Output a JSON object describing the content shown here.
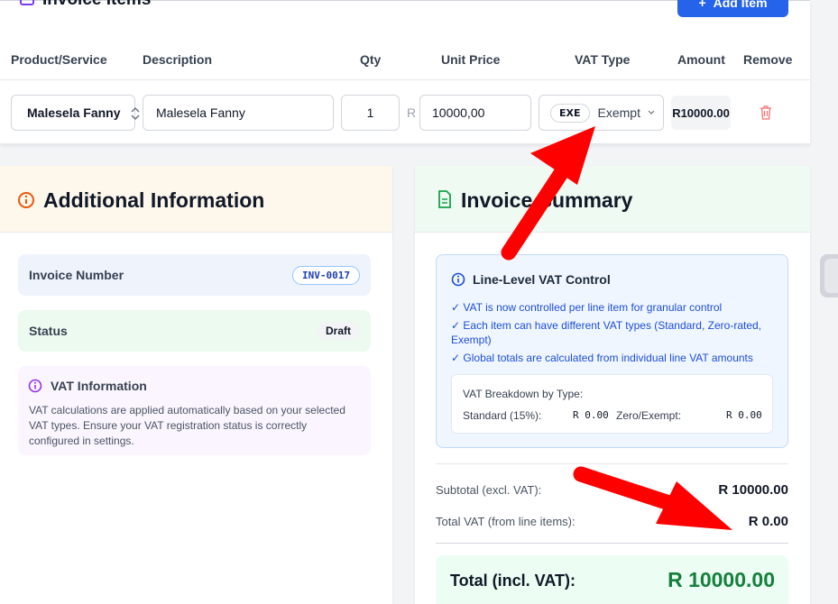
{
  "items": {
    "title": "Invoice Items",
    "add_label": "Add Item",
    "headers": {
      "product": "Product/Service",
      "description": "Description",
      "qty": "Qty",
      "unit_price": "Unit Price",
      "vat_type": "VAT Type",
      "amount": "Amount",
      "remove": "Remove"
    },
    "row": {
      "product": "Malesela Fanny",
      "description": "Malesela Fanny",
      "qty": "1",
      "currency": "R",
      "unit_price": "10000,00",
      "vat_badge": "EXE",
      "vat_type": "Exempt",
      "amount": "R10000.00"
    }
  },
  "additional": {
    "title": "Additional Information",
    "invoice_number_label": "Invoice Number",
    "invoice_number": "INV-0017",
    "status_label": "Status",
    "status": "Draft",
    "vat_title": "VAT Information",
    "vat_text": "VAT calculations are applied automatically based on your selected VAT types. Ensure your VAT registration status is correctly configured in settings."
  },
  "summary": {
    "title": "Invoice Summary",
    "vat_control_title": "Line-Level VAT Control",
    "bullets": [
      "✓ VAT is now controlled per line item for granular control",
      "✓ Each item can have different VAT types (Standard, Zero-rated, Exempt)",
      "✓ Global totals are calculated from individual line VAT amounts"
    ],
    "breakdown_title": "VAT Breakdown by Type:",
    "standard_label": "Standard (15%):",
    "standard_value": "R 0.00",
    "zero_label": "Zero/Exempt:",
    "zero_value": "R 0.00",
    "subtotal_label": "Subtotal (excl. VAT):",
    "subtotal_value": "R 10000.00",
    "total_vat_label": "Total VAT (from line items):",
    "total_vat_value": "R 0.00",
    "total_label": "Total (incl. VAT):",
    "total_value": "R 10000.00"
  },
  "colors": {
    "accent": "#2563eb",
    "arrow": "#ff0000",
    "total_green": "#15803d",
    "delete_red": "#f87171"
  }
}
